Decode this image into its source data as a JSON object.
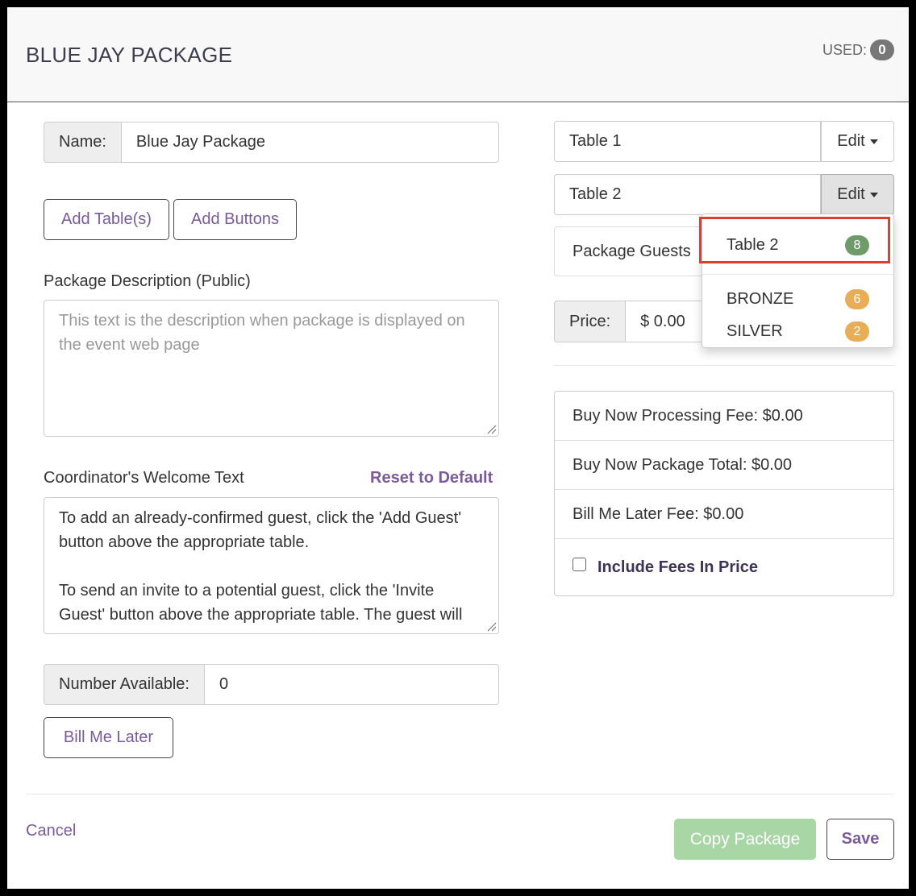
{
  "header": {
    "title": "BLUE JAY PACKAGE",
    "used_label": "USED:",
    "used_count": "0"
  },
  "left": {
    "name_label": "Name:",
    "name_value": "Blue Jay Package",
    "add_tables_button": "Add Table(s)",
    "add_buttons_button": "Add Buttons",
    "description_label": "Package Description (Public)",
    "description_placeholder": "This text is the description when package is displayed on the event web page",
    "welcome_label": "Coordinator's Welcome Text",
    "reset_link": "Reset to Default",
    "welcome_text_1": "To add an already-confirmed guest, click the 'Add Guest' button above the appropriate table.",
    "welcome_text_2": "To send an invite to a potential guest, click the 'Invite Guest' button above the appropriate table. The guest will",
    "number_available_label": "Number Available:",
    "number_available_value": "0",
    "bill_me_later_button": "Bill Me Later"
  },
  "right": {
    "tables": [
      {
        "name": "Table 1",
        "edit_label": "Edit"
      },
      {
        "name": "Table 2",
        "edit_label": "Edit"
      }
    ],
    "package_guests_label": "Package Guests",
    "price_label": "Price:",
    "price_value": "$ 0.00",
    "fees": {
      "processing_fee": "Buy Now Processing Fee: $0.00",
      "package_total": "Buy Now Package Total: $0.00",
      "bill_me_later_fee": "Bill Me Later Fee: $0.00",
      "include_fees_label": "Include Fees In Price"
    }
  },
  "dropdown": {
    "items": [
      {
        "label": "Table 2",
        "count": "8",
        "color": "#6f9a6a"
      },
      {
        "label": "BRONZE",
        "count": "6",
        "color": "#e8ad57"
      },
      {
        "label": "SILVER",
        "count": "2",
        "color": "#e8ad57"
      }
    ]
  },
  "footer": {
    "cancel_link": "Cancel",
    "copy_button": "Copy Package",
    "save_button": "Save"
  }
}
